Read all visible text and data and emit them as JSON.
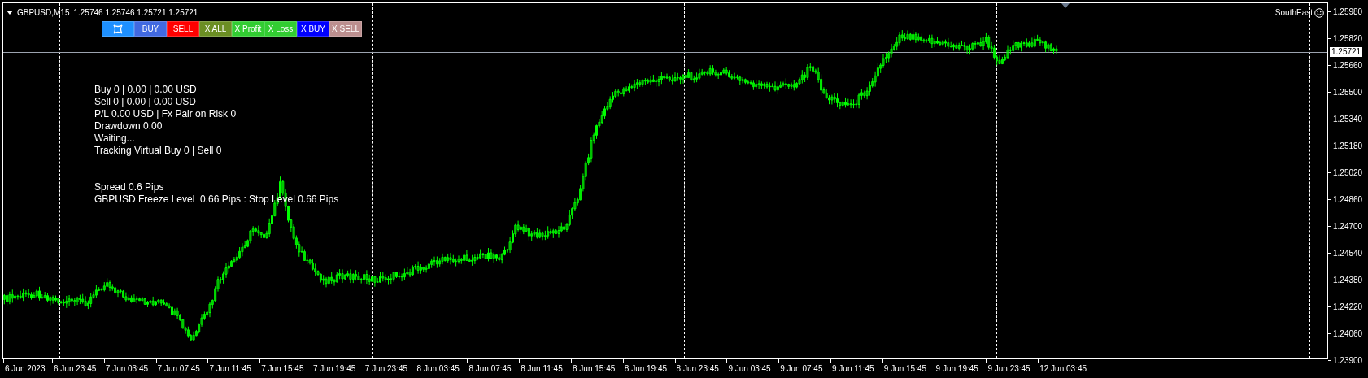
{
  "chart": {
    "symbol": "GBPUSD,M15",
    "quotes": "1.25746 1.25746 1.25721 1.25721",
    "corner_label": "SouthEast"
  },
  "buttons": [
    {
      "kind": "icon",
      "color": "#1e90ff"
    },
    {
      "kind": "text",
      "label": "BUY",
      "color": "#4169e1"
    },
    {
      "kind": "text",
      "label": "SELL",
      "color": "#ff0000"
    },
    {
      "kind": "text",
      "label": "X ALL",
      "color": "#6b8e23"
    },
    {
      "kind": "text",
      "label": "X Profit",
      "color": "#32cd32"
    },
    {
      "kind": "text",
      "label": "X Loss",
      "color": "#32cd32"
    },
    {
      "kind": "text",
      "label": "X BUY",
      "color": "#0000ff"
    },
    {
      "kind": "text",
      "label": "X SELL",
      "color": "#bc8f8f"
    }
  ],
  "status_lines": [
    "Buy 0 | 0.00 | 0.00 USD",
    "Sell 0 | 0.00 | 0.00 USD",
    "P/L 0.00 USD | Fx Pair on Risk 0",
    "Drawdown 0.00",
    "Waiting...",
    "Tracking Virtual Buy 0 | Sell 0"
  ],
  "spread_lines": [
    "Spread 0.6 Pips",
    "GBPUSD Freeze Level  0.66 Pips : Stop Level 0.66 Pips"
  ],
  "price_axis": {
    "labels": [
      "1.25980",
      "1.25820",
      "1.25660",
      "1.25500",
      "1.25340",
      "1.25180",
      "1.25020",
      "1.24860",
      "1.24700",
      "1.24540",
      "1.24380",
      "1.24220",
      "1.24060",
      "1.23900"
    ],
    "current_price": "1.25721"
  },
  "time_axis": {
    "labels": [
      "6 Jun 2023",
      "6 Jun 23:45",
      "7 Jun 03:45",
      "7 Jun 07:45",
      "7 Jun 11:45",
      "7 Jun 15:45",
      "7 Jun 19:45",
      "7 Jun 23:45",
      "8 Jun 03:45",
      "8 Jun 07:45",
      "8 Jun 11:45",
      "8 Jun 15:45",
      "8 Jun 19:45",
      "8 Jun 23:45",
      "9 Jun 03:45",
      "9 Jun 07:45",
      "9 Jun 11:45",
      "9 Jun 15:45",
      "9 Jun 19:45",
      "9 Jun 23:45",
      "12 Jun 03:45"
    ]
  }
}
